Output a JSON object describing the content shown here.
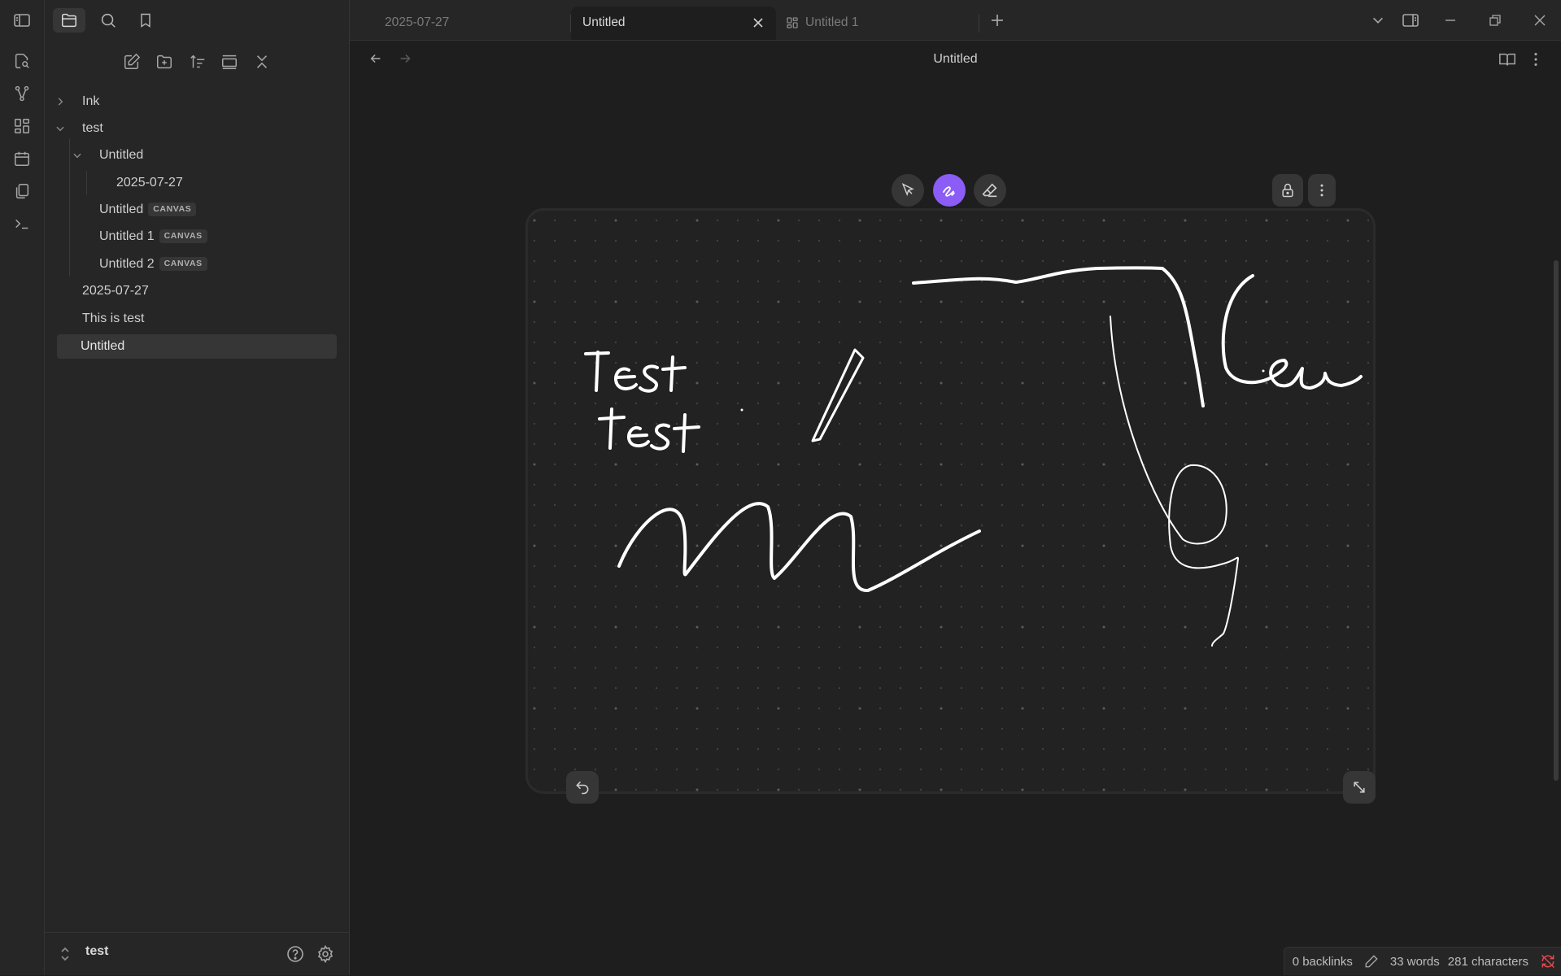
{
  "tabs": [
    {
      "label": "2025-07-27",
      "active": false
    },
    {
      "label": "Untitled",
      "active": true
    },
    {
      "label": "Untitled 1",
      "active": false
    }
  ],
  "view": {
    "title": "Untitled"
  },
  "file_tree": {
    "folder_ink": "Ink",
    "folder_test": "test",
    "folder_untitled": "Untitled",
    "file_date_nested": "2025-07-27",
    "canvas_untitled": "Untitled",
    "canvas_untitled_1": "Untitled 1",
    "canvas_untitled_2": "Untitled 2",
    "canvas_badge": "CANVAS",
    "file_date": "2025-07-27",
    "file_this_is_test": "This is test",
    "file_untitled_selected": "Untitled"
  },
  "vault": {
    "name": "test"
  },
  "status": {
    "backlinks": "0 backlinks",
    "words": "33 words",
    "characters": "281 characters"
  },
  "colors": {
    "accent": "#8b5cf6",
    "background": "#1e1e1e",
    "sidebar": "#262626",
    "ink": "#ffffff",
    "sync_error": "#e5484d"
  },
  "icons": {
    "ribbon": [
      "sidebar-toggle-icon",
      "quick-switcher-icon",
      "graph-icon",
      "canvas-icon",
      "calendar-icon",
      "templates-icon",
      "terminal-icon"
    ],
    "tools": [
      "select-tool-icon",
      "draw-tool-icon",
      "eraser-tool-icon",
      "lock-icon",
      "more-vertical-icon",
      "undo-icon",
      "resize-icon"
    ]
  }
}
